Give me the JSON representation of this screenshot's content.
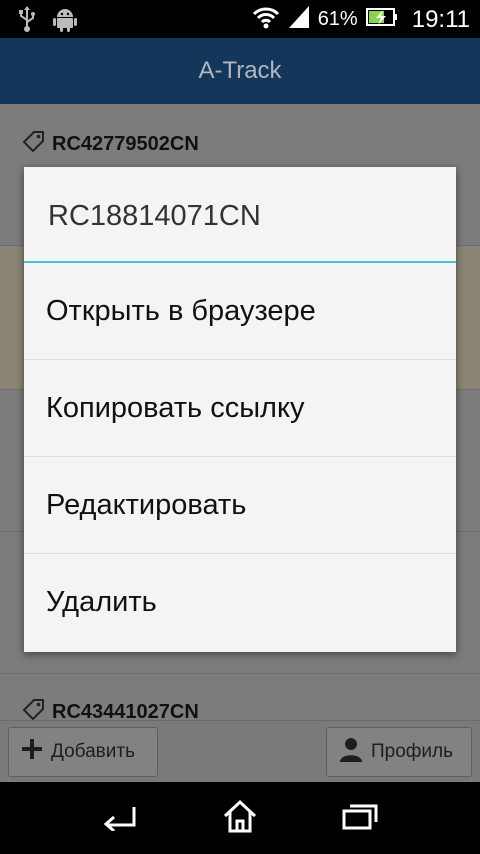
{
  "status_bar": {
    "battery_percent": "61%",
    "time": "19:11",
    "icons": [
      "usb-icon",
      "android-icon",
      "wifi-icon",
      "signal-icon",
      "battery-charging-icon"
    ]
  },
  "app_bar": {
    "title": "A-Track"
  },
  "list": {
    "items": [
      {
        "code": "RC42779502CN"
      },
      {
        "code": "RC43441027CN"
      }
    ]
  },
  "dialog": {
    "title": "RC18814071CN",
    "items": [
      {
        "label": "Открыть в браузере"
      },
      {
        "label": "Копировать ссылку"
      },
      {
        "label": "Редактировать"
      },
      {
        "label": "Удалить"
      }
    ]
  },
  "toolbar": {
    "add_label": "Добавить",
    "profile_label": "Профиль"
  },
  "nav_bar": {
    "icons": [
      "back-icon",
      "home-icon",
      "recent-apps-icon"
    ]
  },
  "colors": {
    "app_bar": "#14365a",
    "dialog_divider": "#43c7d6",
    "dialog_bg": "#f4f4f4"
  }
}
